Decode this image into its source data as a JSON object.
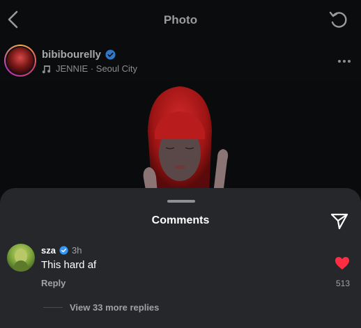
{
  "topbar": {
    "title": "Photo"
  },
  "post": {
    "username": "bibibourelly",
    "music": "JENNIE · Seoul City"
  },
  "comments_sheet": {
    "title": "Comments",
    "comment": {
      "user": "sza",
      "time": "3h",
      "text": "This hard af",
      "reply_label": "Reply",
      "likes": "513"
    },
    "view_replies": "View 33 more replies"
  },
  "colors": {
    "sheet_bg": "#25272b",
    "like_red": "#ff2d41",
    "verified_blue": "#3897f0"
  },
  "icons": [
    "back-icon",
    "refresh-icon",
    "verified-icon",
    "music-note-icon",
    "more-icon",
    "send-icon",
    "heart-icon"
  ]
}
